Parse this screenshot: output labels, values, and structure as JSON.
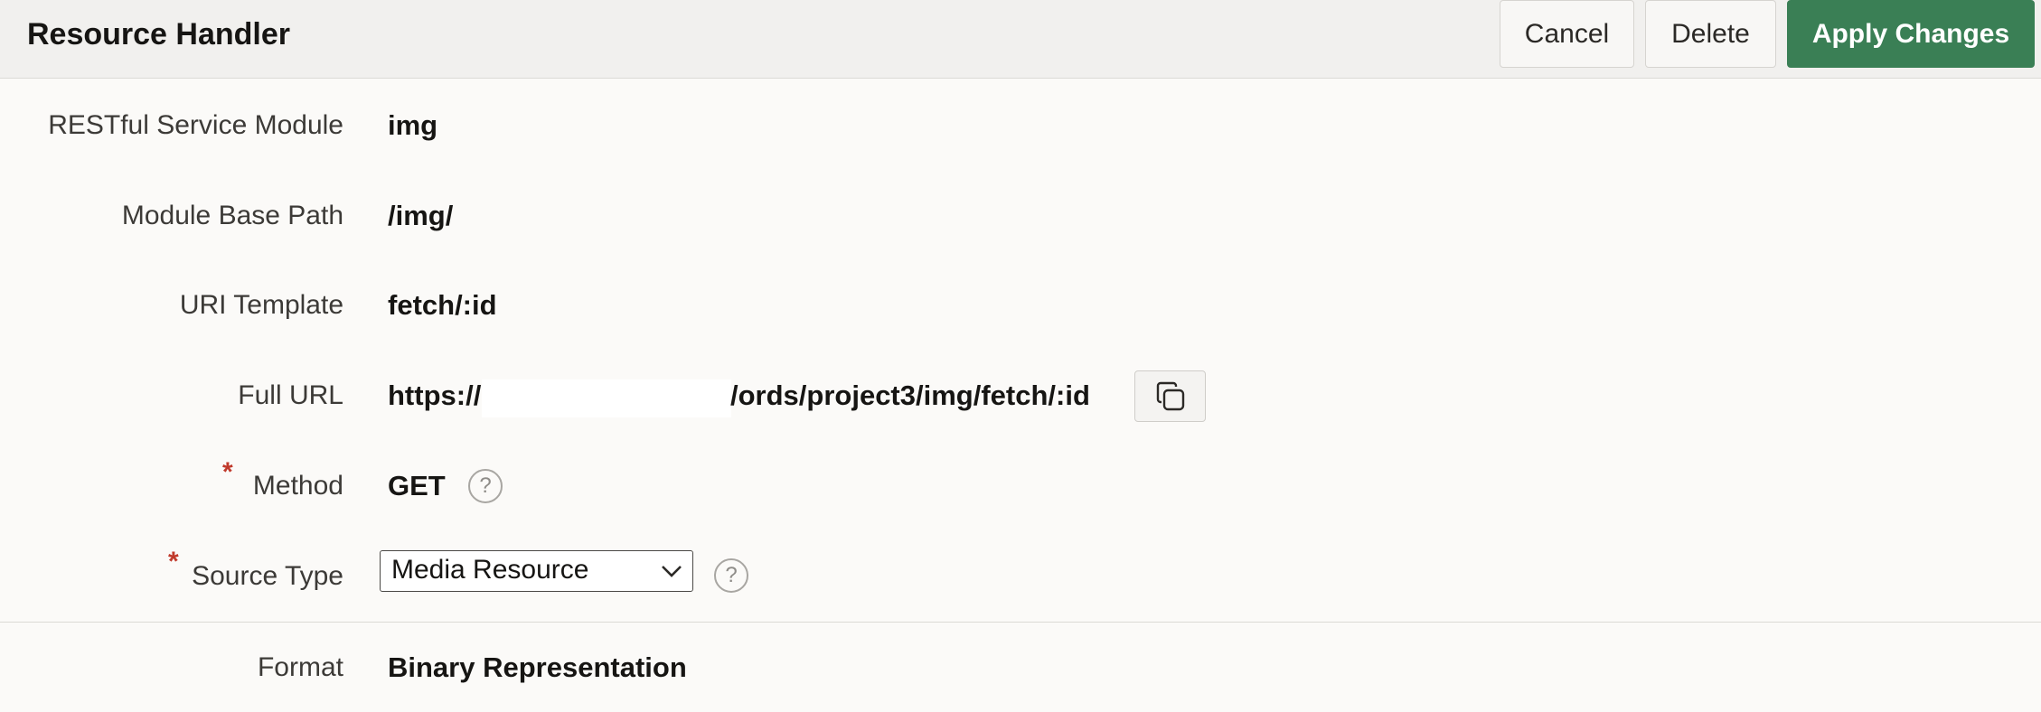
{
  "header": {
    "title": "Resource Handler",
    "cancel_label": "Cancel",
    "delete_label": "Delete",
    "apply_label": "Apply Changes"
  },
  "form": {
    "module": {
      "label": "RESTful Service Module",
      "value": "img"
    },
    "base_path": {
      "label": "Module Base Path",
      "value": "/img/"
    },
    "uri_template": {
      "label": "URI Template",
      "value": "fetch/:id"
    },
    "full_url": {
      "label": "Full URL",
      "prefix": "https://",
      "suffix": "/ords/project3/img/fetch/:id"
    },
    "method": {
      "label": "Method",
      "value": "GET",
      "required_mark": "*"
    },
    "source_type": {
      "label": "Source Type",
      "value": "Media Resource",
      "required_mark": "*"
    },
    "format": {
      "label": "Format",
      "value": "Binary Representation"
    }
  },
  "icons": {
    "help": "?",
    "copy": "copy-icon",
    "chevron": "chevron-down-icon"
  },
  "colors": {
    "accent_green": "#3a7f55",
    "required_red": "#c0392b"
  }
}
